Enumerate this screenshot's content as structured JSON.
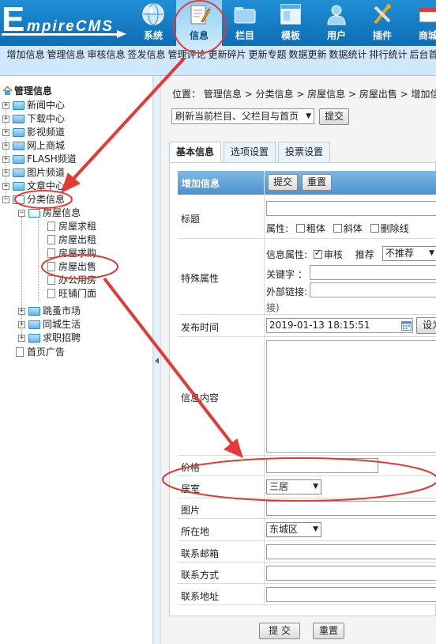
{
  "header": {
    "logo_initial": "E",
    "logo_rest": "mpireCMS",
    "nav": [
      "系统",
      "信息",
      "栏目",
      "模板",
      "用户",
      "插件",
      "商城"
    ],
    "active_nav": "信息"
  },
  "subnav": [
    "增加信息",
    "管理信息",
    "审核信息",
    "签发信息",
    "管理评论",
    "更新碎片",
    "更新专题",
    "数据更新",
    "数据统计",
    "排行统计",
    "后台首页"
  ],
  "tree": {
    "root": "管理信息",
    "channels": [
      "新闻中心",
      "下载中心",
      "影视频道",
      "网上商城",
      "FLASH频道",
      "图片频道",
      "文章中心"
    ],
    "classified": "分类信息",
    "house": "房屋信息",
    "house_items": [
      "房屋求租",
      "房屋出租",
      "房屋求购",
      "房屋出售",
      "办公用房",
      "旺铺门面"
    ],
    "other_groups": [
      "跳蚤市场",
      "同城生活",
      "求职招聘"
    ],
    "homepage_ad": "首页广告"
  },
  "breadcrumb": "位置： 管理信息 > 分类信息 > 房屋信息 > 房屋出售 > 增加信息",
  "refresh_select": "刷新当前栏目、父栏目与首页",
  "submit_label": "提交",
  "tabs": [
    "基本信息",
    "选项设置",
    "投票设置"
  ],
  "form": {
    "head_title": "增加信息",
    "submit": "提交",
    "reset": "重置",
    "title_label": "标题",
    "attr_label": "属性:",
    "attr_options": [
      "粗体",
      "斜体",
      "删除线"
    ],
    "special_label": "特殊属性",
    "info_attr": "信息属性:",
    "review_label": "审核",
    "recommend_label": "推荐",
    "recommend_value": "不推荐",
    "keyword_label": "关键字 ：",
    "external_link": "外部链接:",
    "link_note": "接)",
    "publish_label": "发布时间",
    "publish_value": "2019-01-13 18:15:51",
    "set_button": "设为",
    "content_label": "信息内容",
    "price_label": "价格",
    "rooms_label": "居室",
    "rooms_value": "三居",
    "image_label": "图片",
    "location_label": "所在地",
    "location_value": "东城区",
    "email_label": "联系邮箱",
    "contact_label": "联系方式",
    "address_label": "联系地址",
    "bottom_submit": "提 交",
    "bottom_reset": "重置"
  },
  "colors": {
    "header_blue": "#1479c4",
    "subnav_bg": "#cfe8fb",
    "form_head": "#5a9fd6",
    "annotation_red": "#e53935"
  }
}
